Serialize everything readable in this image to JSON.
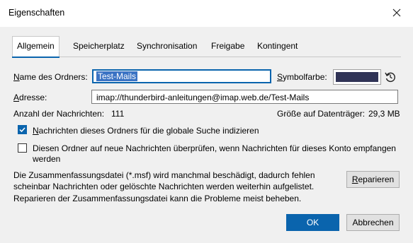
{
  "window": {
    "title": "Eigenschaften",
    "close_icon": "close-icon"
  },
  "tabs": [
    {
      "label": "Allgemein",
      "active": true
    },
    {
      "label": "Speicherplatz"
    },
    {
      "label": "Synchronisation"
    },
    {
      "label": "Freigabe"
    },
    {
      "label": "Kontingent"
    }
  ],
  "folder_name": {
    "label_prefix": "N",
    "label_rest": "ame des Ordners:",
    "value": "Test-Mails"
  },
  "symbol_color": {
    "label_prefix": "S",
    "label_rest": "ymbolfarbe:",
    "color": "#303356",
    "reset_icon": "reset-icon"
  },
  "address": {
    "label_prefix": "A",
    "label_rest": "dresse:",
    "value": "imap://thunderbird-anleitungen@imap.web.de/Test-Mails"
  },
  "stats": {
    "count_label": "Anzahl der Nachrichten:",
    "count_value": "111",
    "size_label": "Größe auf Datenträger:",
    "size_value": "29,3 MB"
  },
  "options": {
    "index_prefix": "N",
    "index_rest": "achrichten dieses Ordners für die globale Suche indizieren",
    "index_checked": true,
    "check_line1": "Diesen Ordner auf neue Nachrichten überprüfen, wenn Nachrichten für dieses Konto empfangen",
    "check_line2": "werden",
    "check_checked": false
  },
  "repair": {
    "line1": "Die Zusammenfassungsdatei (*.msf) wird manchmal beschädigt, dadurch fehlen",
    "line2": "scheinbar Nachrichten oder gelöschte Nachrichten werden weiterhin aufgelistet.",
    "line3": "Reparieren der Zusammenfassungsdatei kann die Probleme meist beheben.",
    "button_prefix": "R",
    "button_rest": "eparieren"
  },
  "buttons": {
    "ok": "OK",
    "cancel": "Abbrechen"
  }
}
